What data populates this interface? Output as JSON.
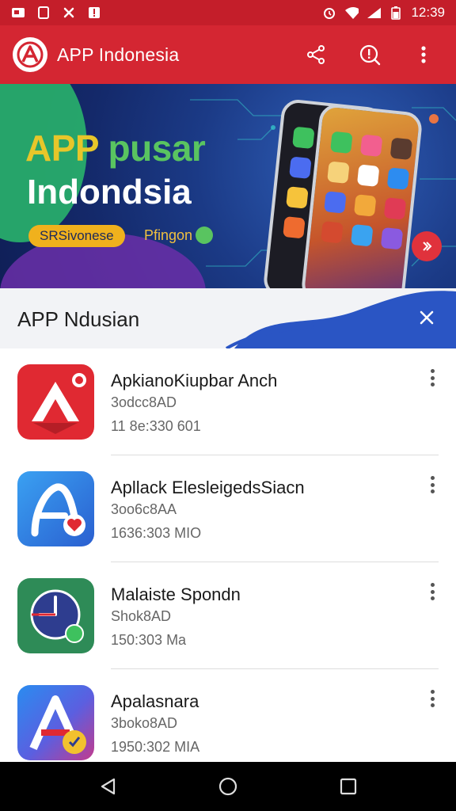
{
  "status_bar": {
    "time": "12:39",
    "icons": [
      "notification-icon",
      "gallery-icon",
      "missed-call-icon",
      "alert-icon",
      "alarm-icon",
      "wifi-icon",
      "signal-icon",
      "battery-icon"
    ]
  },
  "app_bar": {
    "title": "APP Indonesia",
    "actions": [
      "share-icon",
      "info-icon",
      "more-vert-icon"
    ]
  },
  "banner": {
    "title_line1_a": "APP ",
    "title_line1_b": "pusar",
    "title_line2": "Indondsia",
    "pill": "SRSivonese",
    "sub": "Pfingon"
  },
  "section": {
    "title": "APP Ndusian"
  },
  "apps": [
    {
      "name": "ApkianoKiupbar Anch",
      "sub": "3odcc8AD",
      "meta": "11 8e:330 601",
      "icon": "red-a-logo-icon"
    },
    {
      "name": "Apllack ElesleigedsSiacn",
      "sub": "3oo6c8AA",
      "meta": "1636:303 MIO",
      "icon": "blue-a-heart-icon"
    },
    {
      "name": "Malaiste Spondn",
      "sub": "Shok8AD",
      "meta": "150:303 Ma",
      "icon": "green-clock-icon"
    },
    {
      "name": "Apalasnara",
      "sub": "3boko8AD",
      "meta": "1950:302 MIA",
      "icon": "gradient-a-icon"
    }
  ],
  "colors": {
    "primary": "#d42632",
    "status": "#c41e2a",
    "accent_yellow": "#f0b11d",
    "accent_green": "#59c460",
    "banner_blue": "#1b3a86"
  }
}
